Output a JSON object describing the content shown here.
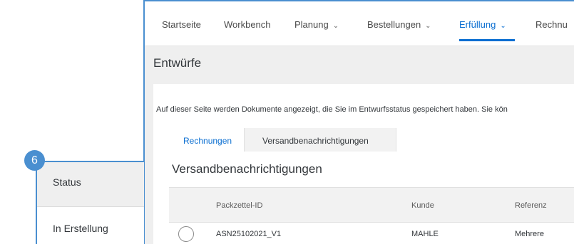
{
  "nav": {
    "items": [
      {
        "label": "Startseite",
        "has_dropdown": false
      },
      {
        "label": "Workbench",
        "has_dropdown": false
      },
      {
        "label": "Planung",
        "has_dropdown": true
      },
      {
        "label": "Bestellungen",
        "has_dropdown": true
      },
      {
        "label": "Erfüllung",
        "has_dropdown": true,
        "active": true
      },
      {
        "label": "Rechnu",
        "has_dropdown": false
      }
    ],
    "chevron": "⌄",
    "accent_color": "#0a6ed1"
  },
  "page": {
    "title": "Entwürfe",
    "info_text": "Auf dieser Seite werden Dokumente angezeigt, die Sie im Entwurfsstatus gespeichert haben. Sie kön"
  },
  "tabs": [
    {
      "label": "Rechnungen",
      "active": true
    },
    {
      "label": "Versandbenachrichtigungen",
      "active": false
    }
  ],
  "section": {
    "title": "Versandbenachrichtigungen"
  },
  "table": {
    "columns": [
      "Packzettel-ID",
      "Kunde",
      "Referenz"
    ],
    "rows": [
      {
        "selected": false,
        "cells": [
          "ASN25102021_V1",
          "MAHLE",
          "Mehrere"
        ]
      }
    ]
  },
  "callout": {
    "step": "6",
    "header": "Status",
    "value": "In Erstellung",
    "color": "#4a8fd0"
  }
}
